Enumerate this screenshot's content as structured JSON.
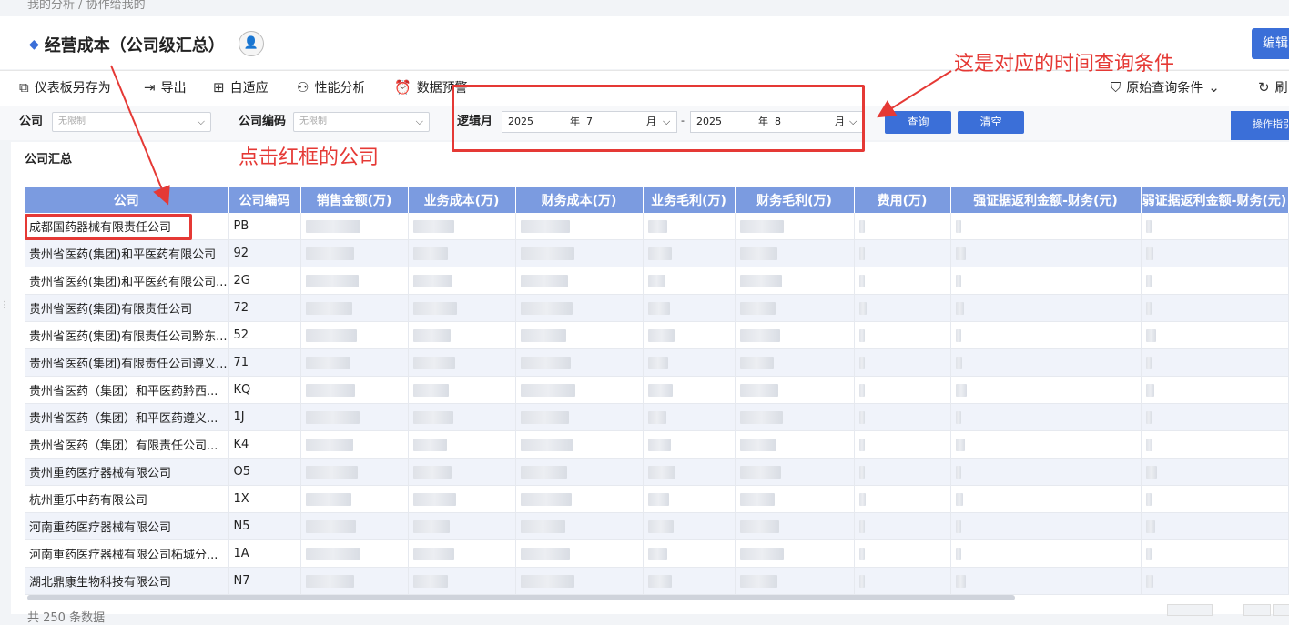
{
  "breadcrumb": "我的分析  /  协作给我的",
  "page_title": "经营成本（公司级汇总）",
  "edit_label": "编辑",
  "toolbar": {
    "save_as": "仪表板另存为",
    "export": "导出",
    "adaptive": "自适应",
    "perf": "性能分析",
    "alert": "数据预警",
    "orig_query": "原始查询条件",
    "refresh": "刷"
  },
  "filters": {
    "company_label": "公司",
    "company_value": "无限制",
    "code_label": "公司编码",
    "code_value": "无限制",
    "month_label": "逻辑月",
    "from_year": "2025",
    "from_month": "7",
    "to_year": "2025",
    "to_month": "8",
    "year_unit": "年",
    "month_unit": "月",
    "dash": "-",
    "query": "查询",
    "clear": "清空",
    "ops": "操作指引"
  },
  "summary_title": "公司汇总",
  "annotations": {
    "click_note": "点击红框的公司",
    "time_note": "这是对应的时间查询条件"
  },
  "table": {
    "headers": [
      "公司",
      "公司编码",
      "销售金额(万)",
      "业务成本(万)",
      "财务成本(万)",
      "业务毛利(万)",
      "财务毛利(万)",
      "费用(万)",
      "强证据返利金额-财务(元)",
      "弱证据返利金额-财务(元)"
    ],
    "rows": [
      {
        "company": "成都国药器械有限责任公司",
        "code": "PB"
      },
      {
        "company": "贵州省医药(集团)和平医药有限公司",
        "code": "92"
      },
      {
        "company": "贵州省医药(集团)和平医药有限公司...",
        "code": "2G"
      },
      {
        "company": "贵州省医药(集团)有限责任公司",
        "code": "72"
      },
      {
        "company": "贵州省医药(集团)有限责任公司黔东...",
        "code": "52"
      },
      {
        "company": "贵州省医药(集团)有限责任公司遵义...",
        "code": "71"
      },
      {
        "company": "贵州省医药（集团）和平医药黔西...",
        "code": "KQ"
      },
      {
        "company": "贵州省医药（集团）和平医药遵义...",
        "code": "1J"
      },
      {
        "company": "贵州省医药（集团）有限责任公司...",
        "code": "K4"
      },
      {
        "company": "贵州重药医疗器械有限公司",
        "code": "O5"
      },
      {
        "company": "杭州重乐中药有限公司",
        "code": "1X"
      },
      {
        "company": "河南重药医疗器械有限公司",
        "code": "N5"
      },
      {
        "company": "河南重药医疗器械有限公司柘城分...",
        "code": "1A"
      },
      {
        "company": "湖北鼎康生物科技有限公司",
        "code": "N7"
      }
    ]
  },
  "footer_text": "共 250 条数据",
  "colors": {
    "accent": "#3b6fd8",
    "header": "#7b9be0",
    "annotation": "#e53935"
  }
}
